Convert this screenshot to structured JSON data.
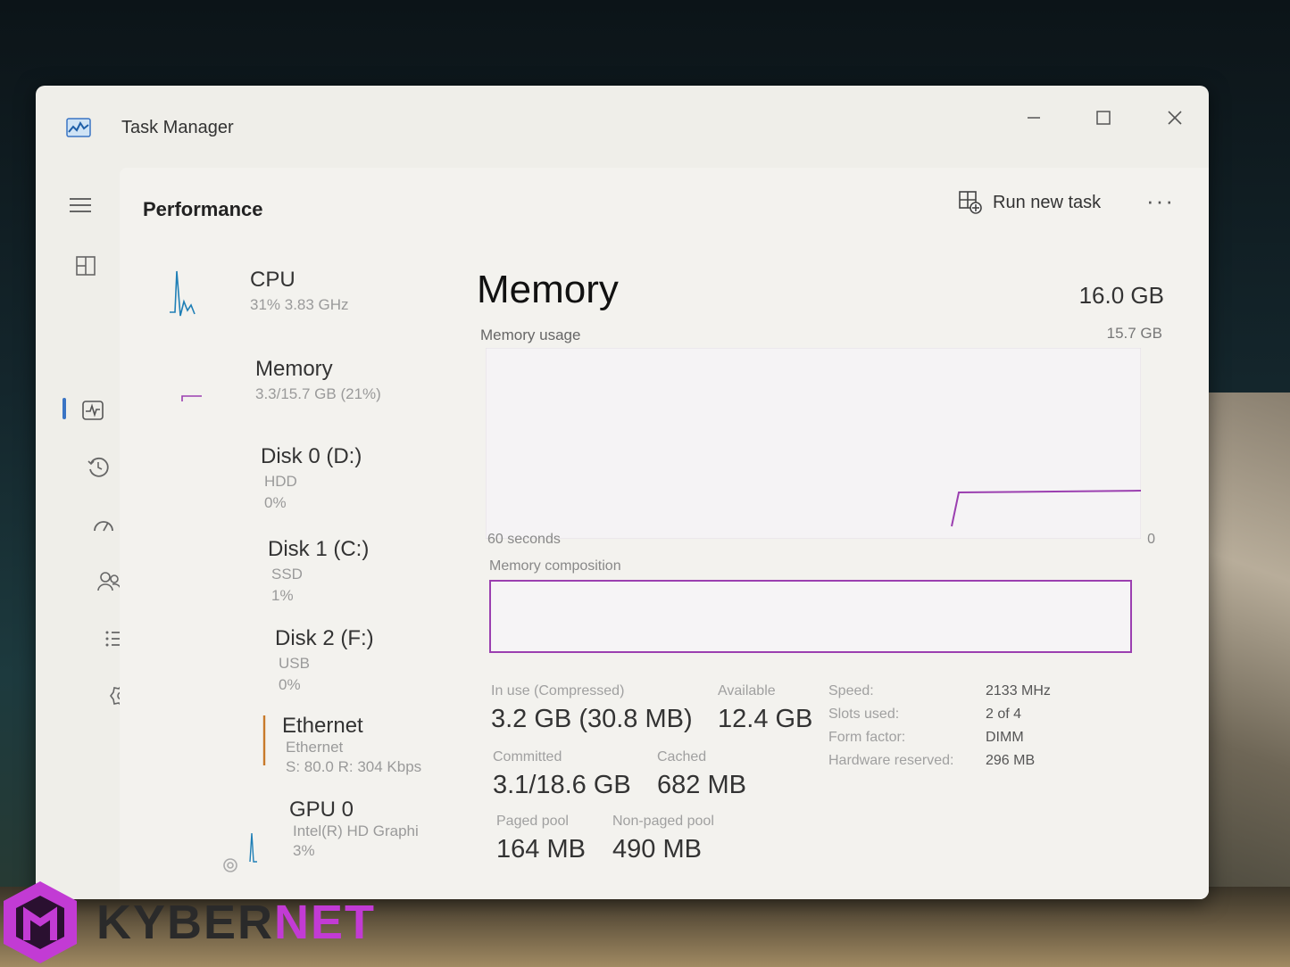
{
  "window": {
    "title": "Task Manager"
  },
  "header": {
    "title": "Performance",
    "run_new_task": "Run new task",
    "more": "···"
  },
  "sidebar_devices": [
    {
      "name": "CPU",
      "sub1": "31% 3.83 GHz",
      "sub2": "",
      "color": "#1f7fb6"
    },
    {
      "name": "Memory",
      "sub1": "3.3/15.7 GB (21%)",
      "sub2": "",
      "color": "#9b3fb0"
    },
    {
      "name": "Disk 0 (D:)",
      "sub1": "HDD",
      "sub2": "0%",
      "color": "#4a9a3a"
    },
    {
      "name": "Disk 1 (C:)",
      "sub1": "SSD",
      "sub2": "1%",
      "color": "#4a9a3a"
    },
    {
      "name": "Disk 2 (F:)",
      "sub1": "USB",
      "sub2": "0%",
      "color": "#4a9a3a"
    },
    {
      "name": "Ethernet",
      "sub1": "Ethernet",
      "sub2": "S: 80.0 R: 304 Kbps",
      "color": "#c8792a"
    },
    {
      "name": "GPU 0",
      "sub1": "Intel(R) HD Graphi",
      "sub2": "3%",
      "color": "#1f7fb6"
    }
  ],
  "memory": {
    "title": "Memory",
    "total": "16.0 GB",
    "usage_label": "Memory usage",
    "usage_max": "15.7 GB",
    "graph_time": "60 seconds",
    "graph_zero": "0",
    "composition_label": "Memory composition",
    "stats": {
      "in_use_label": "In use (Compressed)",
      "in_use_value": "3.2 GB (30.8 MB)",
      "available_label": "Available",
      "available_value": "12.4 GB",
      "committed_label": "Committed",
      "committed_value": "3.1/18.6 GB",
      "cached_label": "Cached",
      "cached_value": "682 MB",
      "paged_pool_label": "Paged pool",
      "paged_pool_value": "164 MB",
      "non_paged_pool_label": "Non-paged pool",
      "non_paged_pool_value": "490 MB"
    },
    "details": [
      {
        "key": "Speed:",
        "value": "2133 MHz"
      },
      {
        "key": "Slots used:",
        "value": "2 of 4"
      },
      {
        "key": "Form factor:",
        "value": "DIMM"
      },
      {
        "key": "Hardware reserved:",
        "value": "296 MB"
      }
    ]
  },
  "watermark": {
    "text_part1": "KYBER",
    "text_part2": "NET"
  },
  "colors": {
    "memory_accent": "#9b3fb0",
    "window_bg": "#efeee9"
  }
}
